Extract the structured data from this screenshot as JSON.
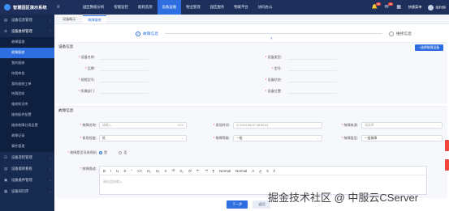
{
  "app": {
    "title": "智慧园区演示系统"
  },
  "topnav": {
    "items": [
      "园区数据分析",
      "智能监控",
      "能耗监测",
      "设备运维",
      "物业管理",
      "园区服务",
      "物联平台",
      "协同办公"
    ],
    "active_index": 3
  },
  "topbar_right": {
    "bell_badge": "15",
    "msg_badge": "16",
    "quick_nav": "快捷菜单",
    "user": "张利琪"
  },
  "sidebar": {
    "groups_before": [
      {
        "label": "设备信息管理",
        "icon": "doc-icon"
      },
      {
        "label": "设备维修管理",
        "icon": "wrench-icon",
        "open": true
      }
    ],
    "items": [
      "故障管理",
      "故障报修",
      "我的报修",
      "待我审批",
      "我的维修工单",
      "待我验收",
      "维修知识库",
      "维修配件配置",
      "维修故障分类设置",
      "故障记录",
      "事件管理"
    ],
    "active_index": 1,
    "groups_after": [
      {
        "label": "设备巡检管理",
        "icon": "check-icon"
      },
      {
        "label": "设备能耗看板",
        "icon": "chart-icon"
      },
      {
        "label": "设备备件管理",
        "icon": "box-icon"
      },
      {
        "label": "设备知识库",
        "icon": "book-icon"
      }
    ]
  },
  "tabs": [
    {
      "label": "设备概示"
    },
    {
      "label": "故障报修",
      "active": true
    }
  ],
  "steps": [
    {
      "label": "故障信息",
      "state": "done"
    },
    {
      "label": "维修信息",
      "state": "todo"
    }
  ],
  "device_info": {
    "title": "设备信息",
    "button": "+选择故障设备",
    "left": [
      "设备名称",
      "品牌",
      "规格型号",
      "所属部门"
    ],
    "right": [
      "设备类型",
      "型号",
      "设备状态",
      "设备位置"
    ]
  },
  "fault_info": {
    "title": "故障信息",
    "fault_name_label": "故障名称",
    "fault_name_placeholder": "请输入",
    "fault_name_count": "0/20",
    "time_label": "发现时间",
    "time_value": "2024-08-07 18:55:41",
    "source_label": "故障来源",
    "source_placeholder": "请选择",
    "level_label": "紧急程度",
    "level_value": "低",
    "type_label": "故障等级",
    "type_value": "一般",
    "category_label": "故障类型",
    "category_value": "一般故障",
    "affect_label": "故障是否导致停机",
    "affect_yes": "是",
    "affect_no": "否",
    "desc_label": "故障描述",
    "editor_toolbar": [
      "B",
      "I",
      "U",
      "S",
      "“",
      "</>",
      "H₁",
      "H₂",
      "≡",
      "⁝≡",
      "X₂",
      "X²",
      "⇤",
      "⇥",
      "¶",
      "Normal",
      "Normal",
      "A",
      "A̲",
      "≡",
      "I̸"
    ],
    "editor_placeholder": "请在此处输入"
  },
  "buttons": {
    "next": "下一步",
    "cancel": "返回"
  },
  "watermark": "掘金技术社区 @ 中服云CServer",
  "colors": {
    "primary": "#2d6fe0",
    "topbar": "#1e2f5b",
    "sidebar": "#172a4f",
    "danger": "#f0463c"
  }
}
